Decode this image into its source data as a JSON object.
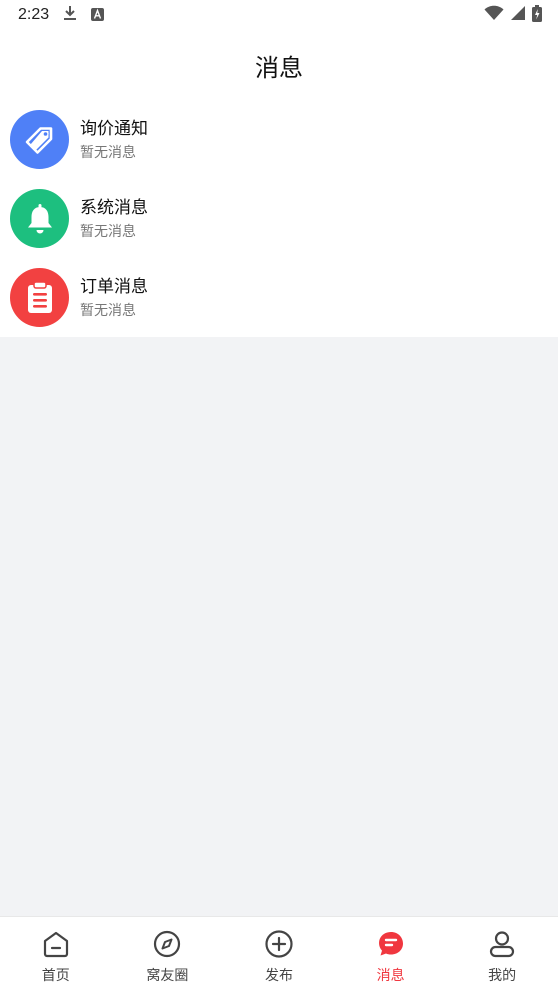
{
  "status_bar": {
    "time": "2:23",
    "icons": [
      "download-icon",
      "a-box-icon",
      "wifi-icon",
      "signal-icon",
      "battery-icon"
    ]
  },
  "header": {
    "title": "消息"
  },
  "messages": [
    {
      "title": "询价通知",
      "subtitle": "暂无消息",
      "icon": "tag-icon",
      "color": "#4f80f7"
    },
    {
      "title": "系统消息",
      "subtitle": "暂无消息",
      "icon": "bell-icon",
      "color": "#1dbf7f"
    },
    {
      "title": "订单消息",
      "subtitle": "暂无消息",
      "icon": "clipboard-icon",
      "color": "#f24141"
    }
  ],
  "tabbar": {
    "active_color": "#f0373f",
    "items": [
      {
        "label": "首页",
        "icon": "home-icon"
      },
      {
        "label": "窝友圈",
        "icon": "compass-icon"
      },
      {
        "label": "发布",
        "icon": "plus-circle-icon"
      },
      {
        "label": "消息",
        "icon": "chat-icon",
        "active": true
      },
      {
        "label": "我的",
        "icon": "user-icon"
      }
    ]
  }
}
